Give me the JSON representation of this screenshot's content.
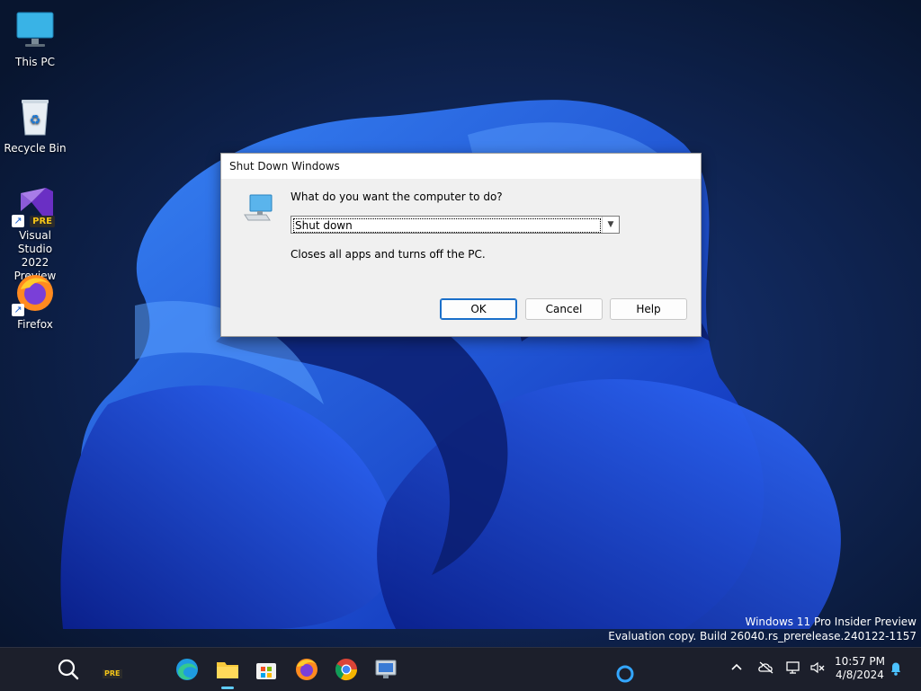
{
  "desktop": {
    "icons": [
      {
        "label": "This PC"
      },
      {
        "label": "Recycle Bin"
      },
      {
        "label": "Visual Studio 2022 Preview",
        "badge": "PRE"
      },
      {
        "label": "Firefox"
      }
    ]
  },
  "dialog": {
    "title": "Shut Down Windows",
    "question": "What do you want the computer to do?",
    "selected_option": "Shut down",
    "description": "Closes all apps and turns off the PC.",
    "buttons": {
      "ok": "OK",
      "cancel": "Cancel",
      "help": "Help"
    }
  },
  "watermark": {
    "line1": "Windows 11 Pro Insider Preview",
    "line2": "Evaluation copy. Build 26040.rs_prerelease.240122-1157"
  },
  "taskbar": {
    "apps": [
      "search-icon",
      "dev-home-icon",
      "edge-icon",
      "file-explorer-icon",
      "store-icon",
      "firefox-icon",
      "chrome-icon",
      "remote-desktop-icon"
    ],
    "dev_badge": "PRE",
    "clock": {
      "time": "10:57 PM",
      "date": "4/8/2024"
    }
  },
  "colors": {
    "accent": "#1a6fc9",
    "taskbar": "#1c1f2b",
    "wallpaper_dark": "#0a1a3c",
    "bloom": "#1f5cff"
  }
}
